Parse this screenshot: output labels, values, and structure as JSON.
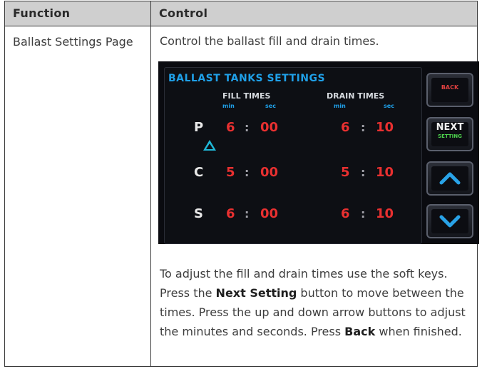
{
  "table": {
    "headers": {
      "function": "Function",
      "control": "Control"
    },
    "row": {
      "function_label": "Ballast Settings Page",
      "intro": "Control the ballast fill and drain times.",
      "para": {
        "t1": "To adjust the fill and drain times use the soft keys. Press the ",
        "b1": "Next Setting",
        "t2": " button to move between the times. Press the up and down arrow buttons to adjust the minutes and seconds.  Press ",
        "b2": "Back",
        "t3": " when finished."
      }
    }
  },
  "screen": {
    "title": "BALLAST TANKS SETTINGS",
    "fill_label": "FILL TIMES",
    "drain_label": "DRAIN TIMES",
    "unit_min": "min",
    "unit_sec": "sec",
    "rows": [
      {
        "letter": "P",
        "fill_min": "6",
        "fill_sec": "00",
        "drain_min": "6",
        "drain_sec": "10"
      },
      {
        "letter": "C",
        "fill_min": "5",
        "fill_sec": "00",
        "drain_min": "5",
        "drain_sec": "10"
      },
      {
        "letter": "S",
        "fill_min": "6",
        "fill_sec": "00",
        "drain_min": "6",
        "drain_sec": "10"
      }
    ],
    "separator": ":",
    "softkeys": {
      "back": "BACK",
      "next": "NEXT",
      "setting": "SETTING"
    },
    "colors": {
      "title": "#1fa0e8",
      "value": "#e83030",
      "cursor": "#1fb8d8",
      "setting": "#4cd04c"
    },
    "icons": {
      "cursor": "triangle-up-outline-icon",
      "up": "chevron-up-icon",
      "down": "chevron-down-icon"
    }
  }
}
